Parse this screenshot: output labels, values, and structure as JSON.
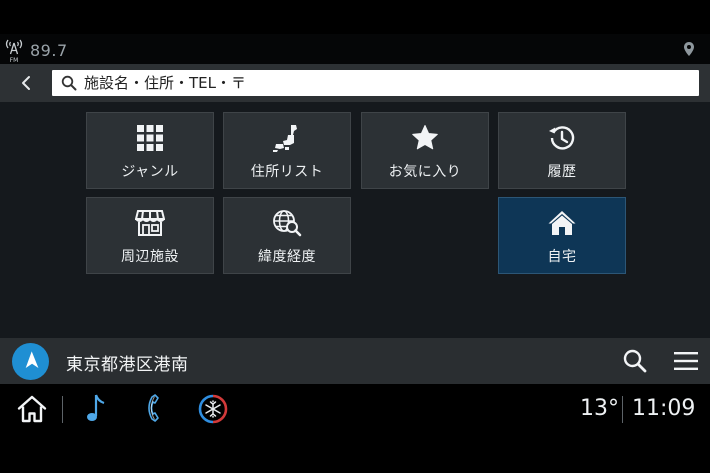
{
  "status": {
    "radio_band": "FM",
    "radio_frequency": "89.7"
  },
  "search": {
    "placeholder": "施設名・住所・TEL・〒"
  },
  "tiles": [
    {
      "label": "ジャンル",
      "icon": "grid-icon"
    },
    {
      "label": "住所リスト",
      "icon": "japan-map-icon"
    },
    {
      "label": "お気に入り",
      "icon": "star-icon"
    },
    {
      "label": "履歴",
      "icon": "history-icon"
    },
    {
      "label": "周辺施設",
      "icon": "store-icon"
    },
    {
      "label": "緯度経度",
      "icon": "globe-search-icon"
    },
    {
      "label": "自宅",
      "icon": "home-icon"
    }
  ],
  "nav": {
    "location": "東京都港区港南"
  },
  "bottom": {
    "temperature": "13°",
    "time": "11:09"
  },
  "colors": {
    "accent_blue": "#1f8fd3",
    "home_tile": "#0e3656",
    "tile": "#2c3135",
    "climate_red": "#d23a3a"
  }
}
